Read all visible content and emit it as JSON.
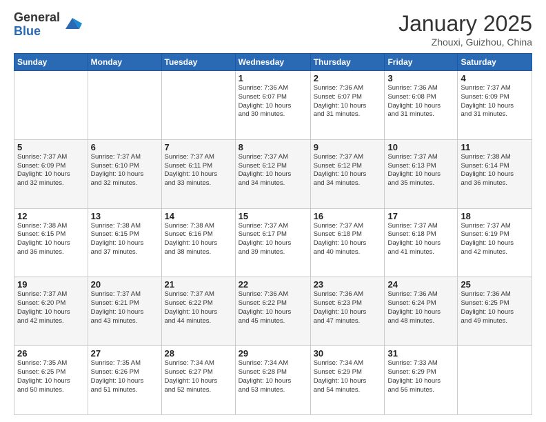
{
  "header": {
    "logo_general": "General",
    "logo_blue": "Blue",
    "month_title": "January 2025",
    "location": "Zhouxi, Guizhou, China"
  },
  "days_of_week": [
    "Sunday",
    "Monday",
    "Tuesday",
    "Wednesday",
    "Thursday",
    "Friday",
    "Saturday"
  ],
  "weeks": [
    [
      {
        "day": "",
        "info": ""
      },
      {
        "day": "",
        "info": ""
      },
      {
        "day": "",
        "info": ""
      },
      {
        "day": "1",
        "info": "Sunrise: 7:36 AM\nSunset: 6:07 PM\nDaylight: 10 hours\nand 30 minutes."
      },
      {
        "day": "2",
        "info": "Sunrise: 7:36 AM\nSunset: 6:07 PM\nDaylight: 10 hours\nand 31 minutes."
      },
      {
        "day": "3",
        "info": "Sunrise: 7:36 AM\nSunset: 6:08 PM\nDaylight: 10 hours\nand 31 minutes."
      },
      {
        "day": "4",
        "info": "Sunrise: 7:37 AM\nSunset: 6:09 PM\nDaylight: 10 hours\nand 31 minutes."
      }
    ],
    [
      {
        "day": "5",
        "info": "Sunrise: 7:37 AM\nSunset: 6:09 PM\nDaylight: 10 hours\nand 32 minutes."
      },
      {
        "day": "6",
        "info": "Sunrise: 7:37 AM\nSunset: 6:10 PM\nDaylight: 10 hours\nand 32 minutes."
      },
      {
        "day": "7",
        "info": "Sunrise: 7:37 AM\nSunset: 6:11 PM\nDaylight: 10 hours\nand 33 minutes."
      },
      {
        "day": "8",
        "info": "Sunrise: 7:37 AM\nSunset: 6:12 PM\nDaylight: 10 hours\nand 34 minutes."
      },
      {
        "day": "9",
        "info": "Sunrise: 7:37 AM\nSunset: 6:12 PM\nDaylight: 10 hours\nand 34 minutes."
      },
      {
        "day": "10",
        "info": "Sunrise: 7:37 AM\nSunset: 6:13 PM\nDaylight: 10 hours\nand 35 minutes."
      },
      {
        "day": "11",
        "info": "Sunrise: 7:38 AM\nSunset: 6:14 PM\nDaylight: 10 hours\nand 36 minutes."
      }
    ],
    [
      {
        "day": "12",
        "info": "Sunrise: 7:38 AM\nSunset: 6:15 PM\nDaylight: 10 hours\nand 36 minutes."
      },
      {
        "day": "13",
        "info": "Sunrise: 7:38 AM\nSunset: 6:15 PM\nDaylight: 10 hours\nand 37 minutes."
      },
      {
        "day": "14",
        "info": "Sunrise: 7:38 AM\nSunset: 6:16 PM\nDaylight: 10 hours\nand 38 minutes."
      },
      {
        "day": "15",
        "info": "Sunrise: 7:37 AM\nSunset: 6:17 PM\nDaylight: 10 hours\nand 39 minutes."
      },
      {
        "day": "16",
        "info": "Sunrise: 7:37 AM\nSunset: 6:18 PM\nDaylight: 10 hours\nand 40 minutes."
      },
      {
        "day": "17",
        "info": "Sunrise: 7:37 AM\nSunset: 6:18 PM\nDaylight: 10 hours\nand 41 minutes."
      },
      {
        "day": "18",
        "info": "Sunrise: 7:37 AM\nSunset: 6:19 PM\nDaylight: 10 hours\nand 42 minutes."
      }
    ],
    [
      {
        "day": "19",
        "info": "Sunrise: 7:37 AM\nSunset: 6:20 PM\nDaylight: 10 hours\nand 42 minutes."
      },
      {
        "day": "20",
        "info": "Sunrise: 7:37 AM\nSunset: 6:21 PM\nDaylight: 10 hours\nand 43 minutes."
      },
      {
        "day": "21",
        "info": "Sunrise: 7:37 AM\nSunset: 6:22 PM\nDaylight: 10 hours\nand 44 minutes."
      },
      {
        "day": "22",
        "info": "Sunrise: 7:36 AM\nSunset: 6:22 PM\nDaylight: 10 hours\nand 45 minutes."
      },
      {
        "day": "23",
        "info": "Sunrise: 7:36 AM\nSunset: 6:23 PM\nDaylight: 10 hours\nand 47 minutes."
      },
      {
        "day": "24",
        "info": "Sunrise: 7:36 AM\nSunset: 6:24 PM\nDaylight: 10 hours\nand 48 minutes."
      },
      {
        "day": "25",
        "info": "Sunrise: 7:36 AM\nSunset: 6:25 PM\nDaylight: 10 hours\nand 49 minutes."
      }
    ],
    [
      {
        "day": "26",
        "info": "Sunrise: 7:35 AM\nSunset: 6:25 PM\nDaylight: 10 hours\nand 50 minutes."
      },
      {
        "day": "27",
        "info": "Sunrise: 7:35 AM\nSunset: 6:26 PM\nDaylight: 10 hours\nand 51 minutes."
      },
      {
        "day": "28",
        "info": "Sunrise: 7:34 AM\nSunset: 6:27 PM\nDaylight: 10 hours\nand 52 minutes."
      },
      {
        "day": "29",
        "info": "Sunrise: 7:34 AM\nSunset: 6:28 PM\nDaylight: 10 hours\nand 53 minutes."
      },
      {
        "day": "30",
        "info": "Sunrise: 7:34 AM\nSunset: 6:29 PM\nDaylight: 10 hours\nand 54 minutes."
      },
      {
        "day": "31",
        "info": "Sunrise: 7:33 AM\nSunset: 6:29 PM\nDaylight: 10 hours\nand 56 minutes."
      },
      {
        "day": "",
        "info": ""
      }
    ]
  ]
}
